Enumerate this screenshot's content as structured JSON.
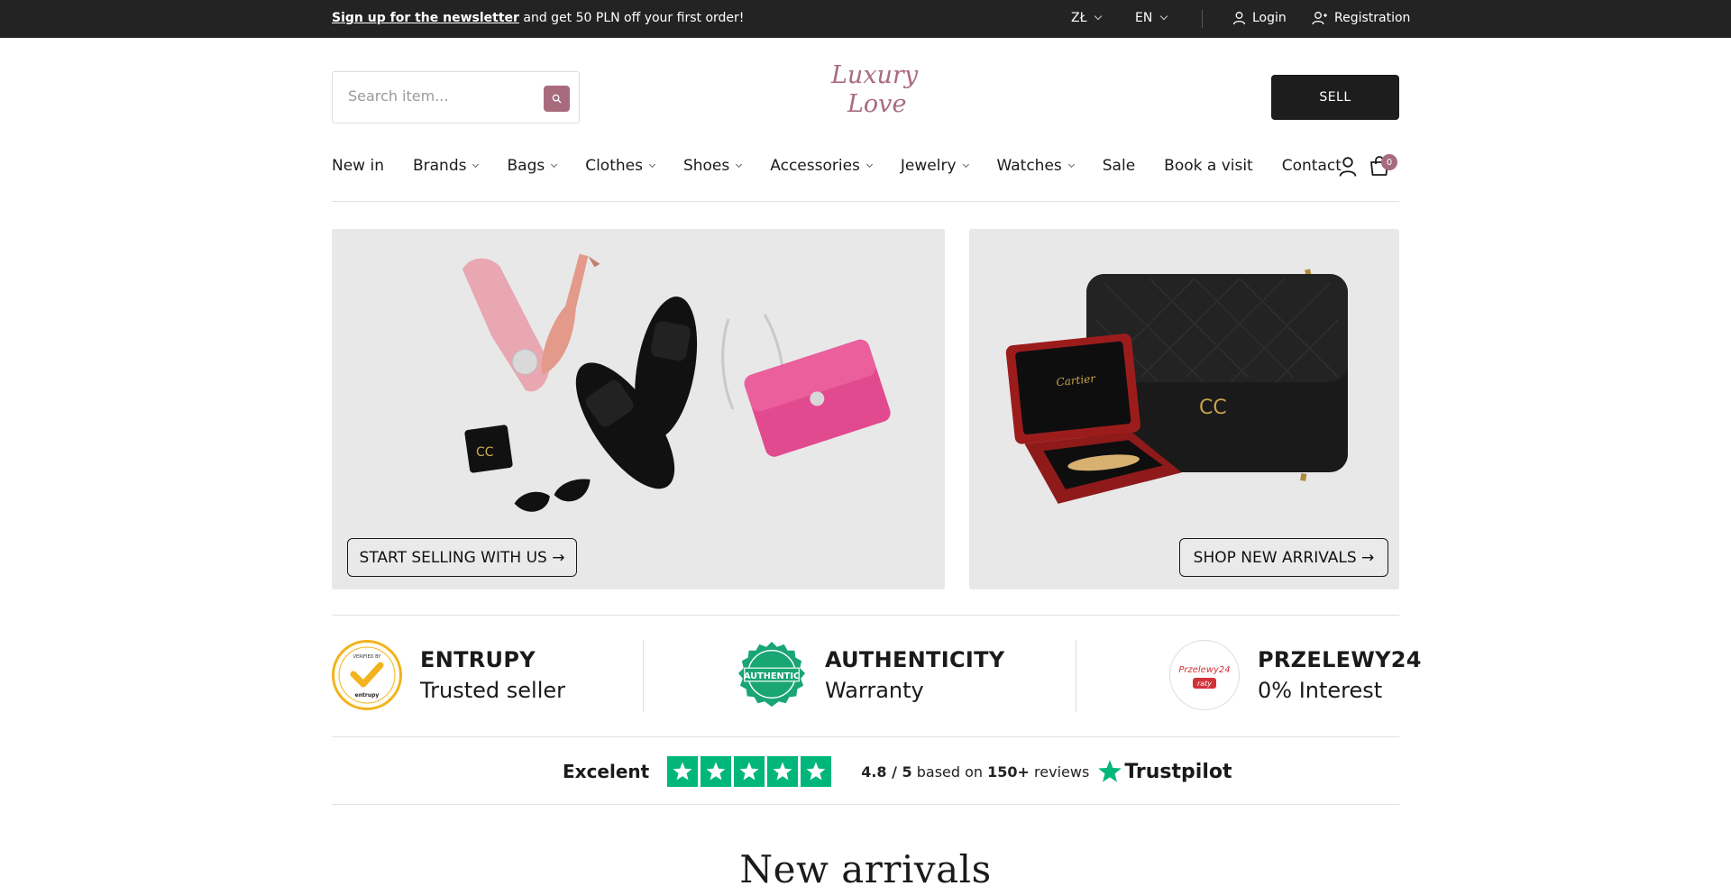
{
  "topbar": {
    "promo_link": "Sign up for the newsletter",
    "promo_text": " and get 50 PLN off your first order!",
    "currency": "ZŁ",
    "language": "EN",
    "login": "Login",
    "registration": "Registration"
  },
  "header": {
    "search_placeholder": "Search item...",
    "logo_line1": "Luxury",
    "logo_line2": "Love",
    "sell_label": "SELL"
  },
  "nav": {
    "items": [
      {
        "label": "New in",
        "dropdown": false
      },
      {
        "label": "Brands",
        "dropdown": true
      },
      {
        "label": "Bags",
        "dropdown": true
      },
      {
        "label": "Clothes",
        "dropdown": true
      },
      {
        "label": "Shoes",
        "dropdown": true
      },
      {
        "label": "Accessories",
        "dropdown": true
      },
      {
        "label": "Jewelry",
        "dropdown": true
      },
      {
        "label": "Watches",
        "dropdown": true
      },
      {
        "label": "Sale",
        "dropdown": false
      },
      {
        "label": "Book a visit",
        "dropdown": false
      },
      {
        "label": "Contact",
        "dropdown": false
      }
    ],
    "cart_count": "0"
  },
  "banners": {
    "left_button": "START SELLING WITH US →",
    "right_button": "SHOP NEW ARRIVALS →",
    "cartier_text": "Cartier"
  },
  "badges": [
    {
      "title": "ENTRUPY",
      "subtitle": "Trusted seller",
      "icon": "entrupy-verified-icon",
      "logo_text_top": "VERIFIED BY",
      "logo_text_bottom": "entrupy"
    },
    {
      "title": "AUTHENTICITY",
      "subtitle": "Warranty",
      "icon": "authentic-seal-icon",
      "logo_text": "AUTHENTIC"
    },
    {
      "title": "PRZELEWY24",
      "subtitle": "0% Interest",
      "icon": "przelewy24-icon",
      "logo_text": "Przelewy24",
      "logo_sub": "raty"
    }
  ],
  "trustpilot": {
    "rating_word": "Excelent",
    "stars": 5,
    "score": "4.8 / 5",
    "based_on": " based on ",
    "count": "150+",
    "reviews": " reviews",
    "brand": "Trustpilot",
    "color": "#00b67a"
  },
  "section_title": "New arrivals",
  "colors": {
    "accent": "#a86b7e",
    "topbar": "#232323",
    "trustpilot_green": "#00b67a"
  }
}
